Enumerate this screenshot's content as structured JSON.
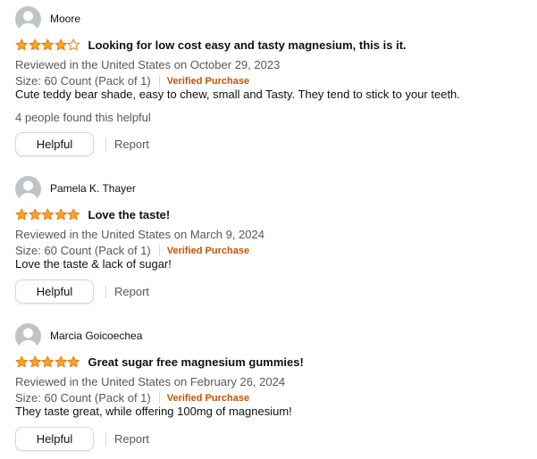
{
  "colors": {
    "star_fill": "#ffa41c",
    "star_outline": "#de7921",
    "verified": "#c45500",
    "muted_text": "#565959",
    "primary_text": "#0f1111",
    "border": "#d5d9d9",
    "avatar_bg": "#bfc4c8"
  },
  "icons": {
    "avatar": "user-silhouette-icon",
    "star": "star-icon"
  },
  "reviews": [
    {
      "reviewer": "Moore",
      "rating": 4,
      "max_rating": 5,
      "title": "Looking for low cost easy and tasty magnesium, this is it.",
      "date_line": "Reviewed in the United States on October 29, 2023",
      "size": "Size: 60 Count (Pack of 1)",
      "verified": "Verified Purchase",
      "body": "Cute teddy bear shade, easy to chew, small and Tasty. They tend to stick to your teeth.",
      "helpful_count": "4 people found this helpful",
      "helpful_label": "Helpful",
      "report_label": "Report"
    },
    {
      "reviewer": "Pamela K. Thayer",
      "rating": 5,
      "max_rating": 5,
      "title": "Love the taste!",
      "date_line": "Reviewed in the United States on March 9, 2024",
      "size": "Size: 60 Count (Pack of 1)",
      "verified": "Verified Purchase",
      "body": "Love the taste & lack of sugar!",
      "helpful_label": "Helpful",
      "report_label": "Report"
    },
    {
      "reviewer": "Marcia Goicoechea",
      "rating": 5,
      "max_rating": 5,
      "title": "Great sugar free magnesium gummies!",
      "date_line": "Reviewed in the United States on February 26, 2024",
      "size": "Size: 60 Count (Pack of 1)",
      "verified": "Verified Purchase",
      "body": "They taste great, while offering 100mg of magnesium!",
      "helpful_label": "Helpful",
      "report_label": "Report"
    }
  ]
}
